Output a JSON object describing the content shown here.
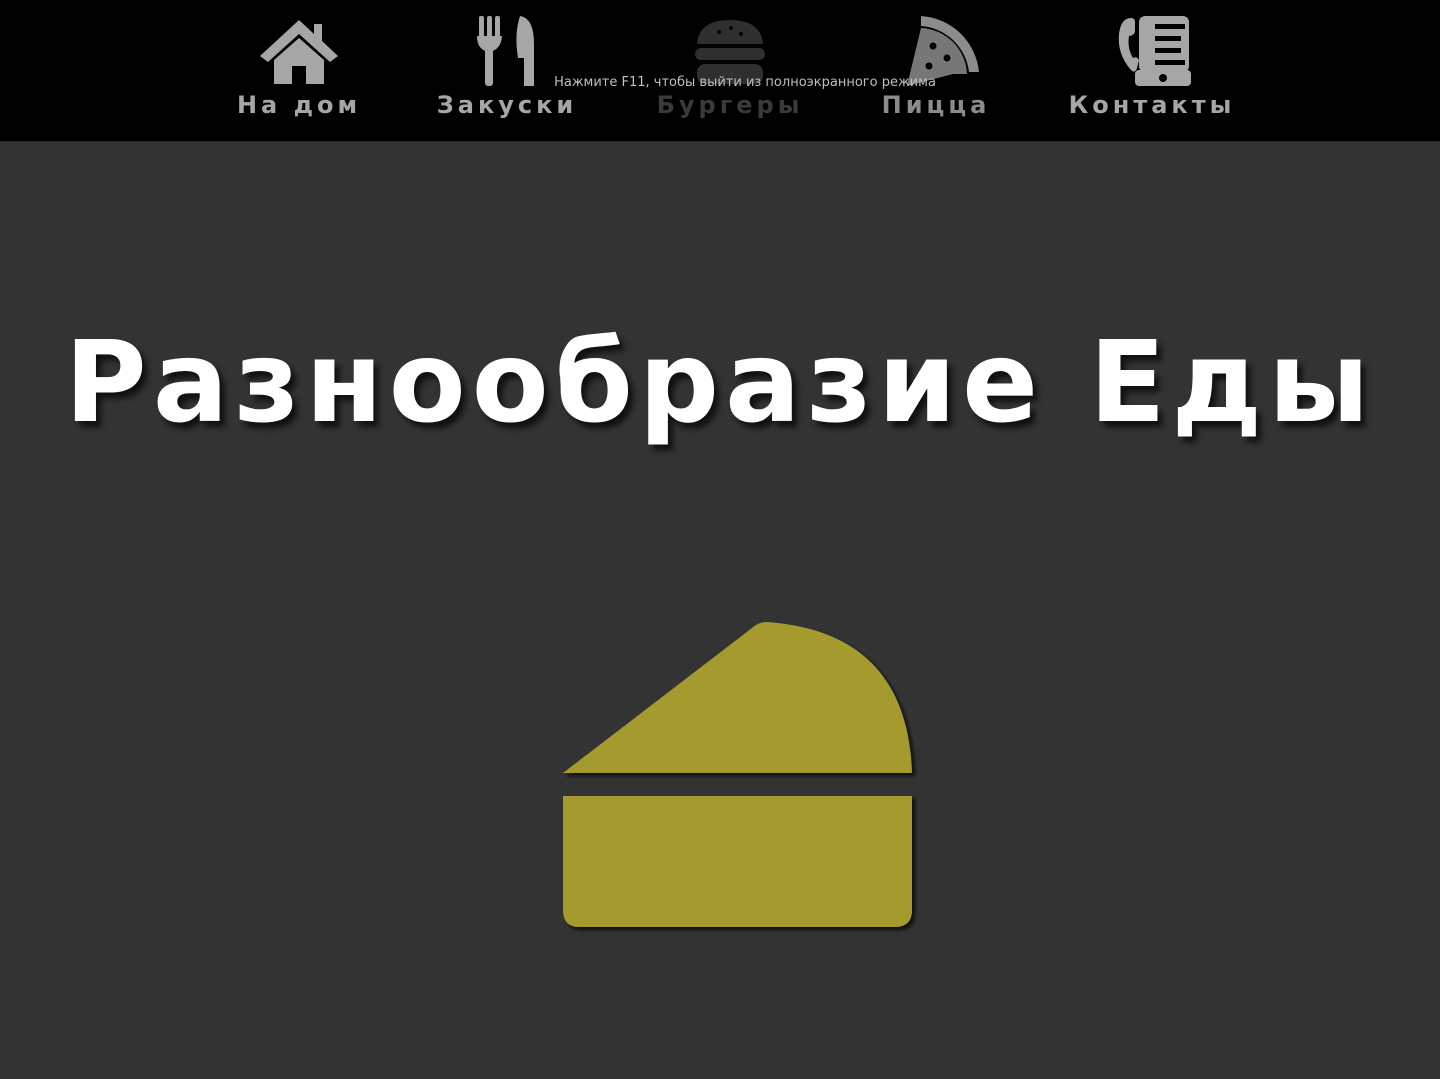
{
  "nav": {
    "items": [
      {
        "label": "На дом",
        "icon": "home-icon"
      },
      {
        "label": "Закуски",
        "icon": "fork-knife-icon"
      },
      {
        "label": "Бургеры",
        "icon": "burger-icon"
      },
      {
        "label": "Пицца",
        "icon": "pizza-icon"
      },
      {
        "label": "Контакты",
        "icon": "phone-icon"
      }
    ]
  },
  "fullscreen_hint": "Нажмите F11, чтобы выйти из полноэкранного режима",
  "hero": {
    "title": "Разнообразие Еды",
    "illustration": "cake-slice-icon"
  },
  "colors": {
    "background": "#333333",
    "nav_background": "#000000",
    "nav_text": "#a6a6a6",
    "title": "#ffffff",
    "cake": "#a49a2e"
  }
}
